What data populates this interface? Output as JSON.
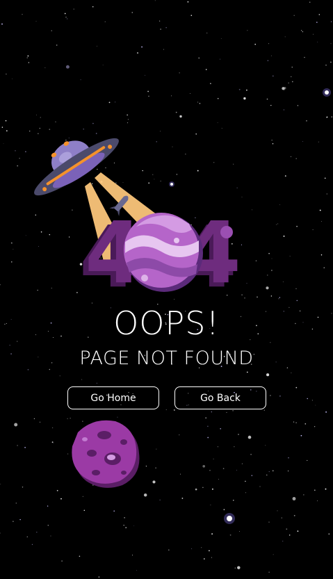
{
  "error": {
    "code_digit_left": "4",
    "code_digit_right": "4",
    "heading": "OOPS!",
    "subheading": "PAGE NOT FOUND"
  },
  "actions": {
    "home_label": "Go Home",
    "back_label": "Go Back"
  },
  "icons": {
    "ufo": "ufo-icon",
    "planet": "planet-icon",
    "asteroid": "asteroid-icon",
    "rocket": "rocket-icon"
  },
  "colors": {
    "background": "#000000",
    "digit": "#6e2c7e",
    "digit_shadow": "#4a1a58",
    "planet": "#b565c9",
    "beam": "#fbc57a",
    "ufo_body": "#4b4a6b",
    "ufo_accent": "#f5922b",
    "asteroid": "#9b3aa5",
    "text": "#ffffff"
  }
}
